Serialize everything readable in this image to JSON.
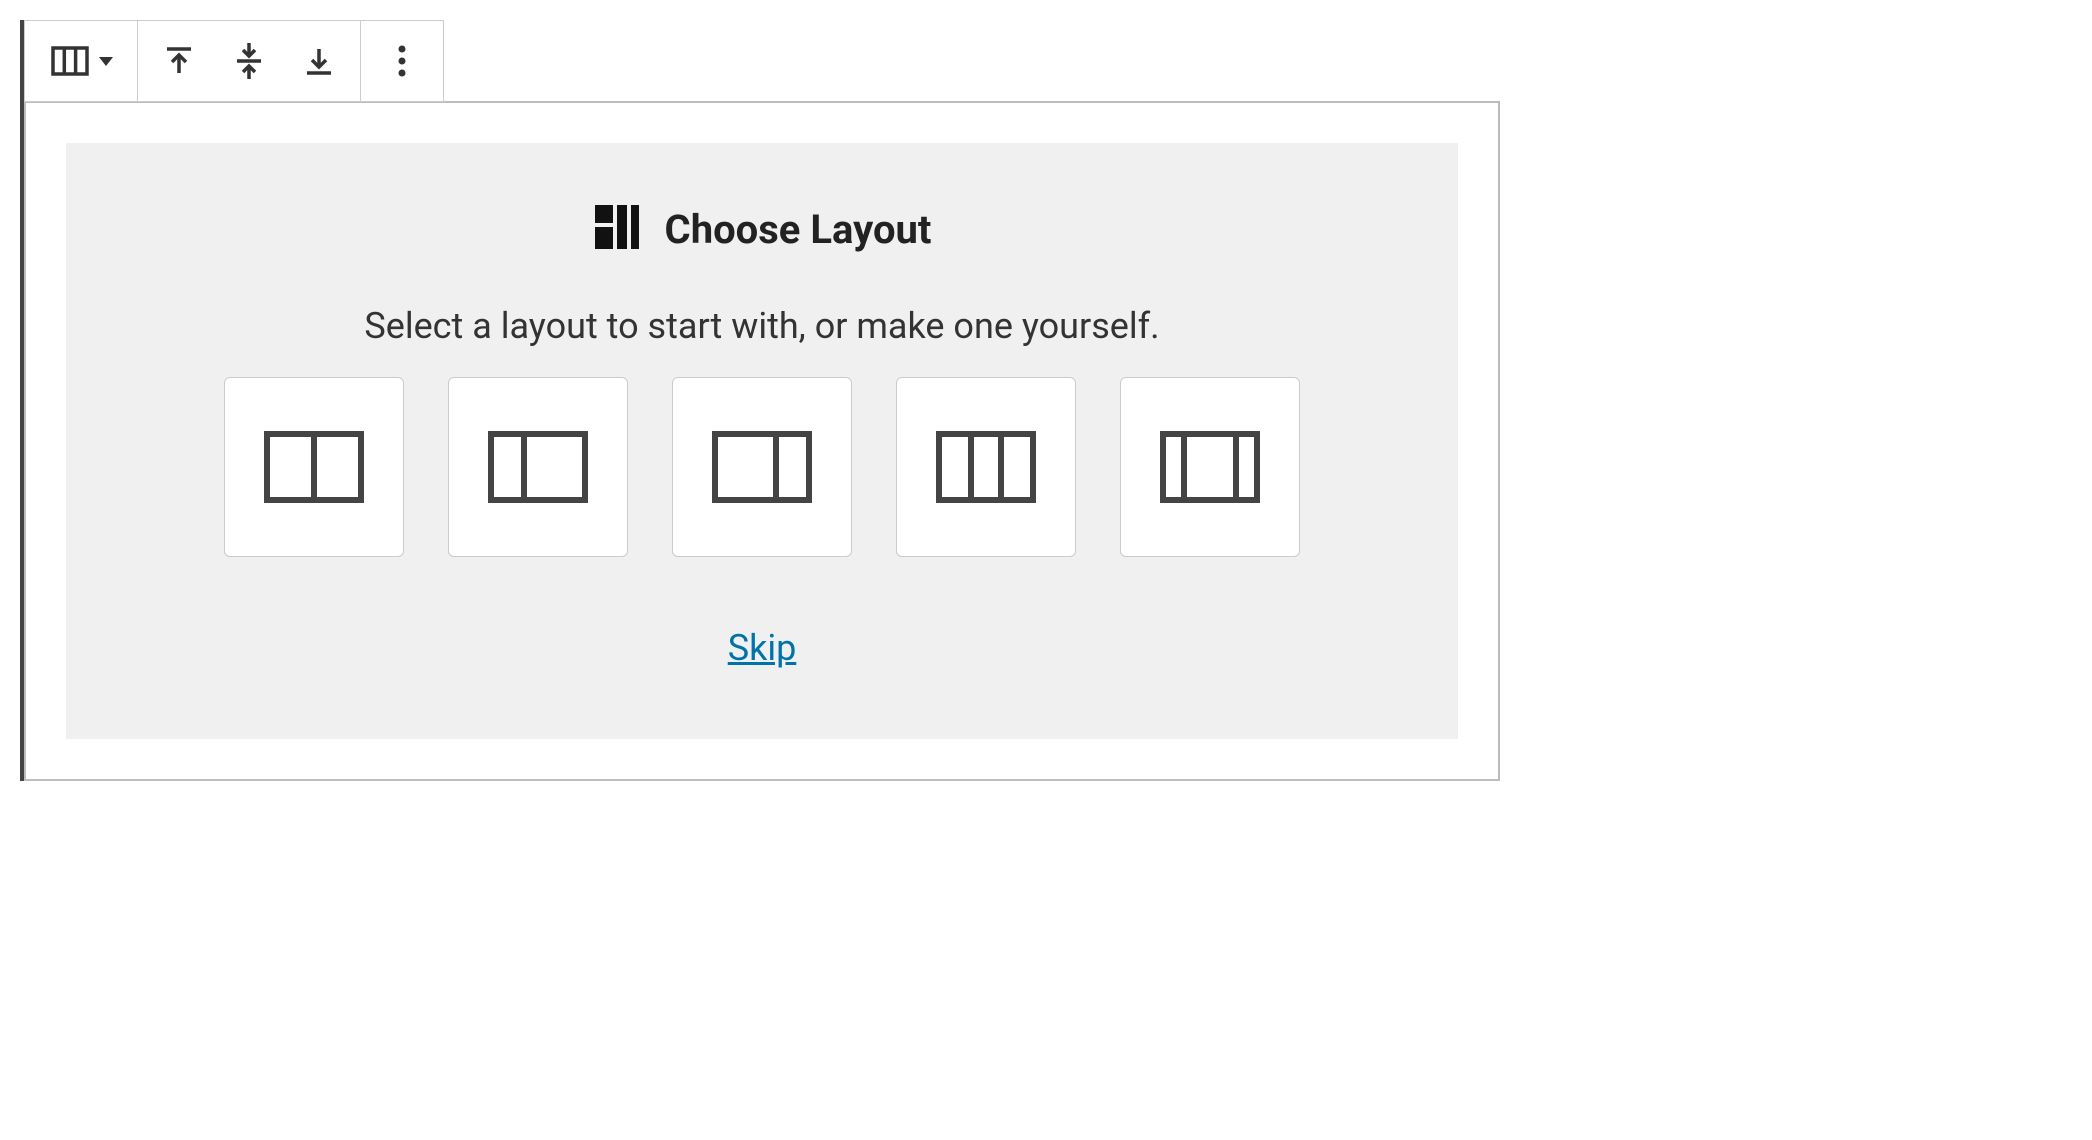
{
  "heading": "Choose Layout",
  "instruction": "Select a layout to start with, or make one yourself.",
  "skip_label": "Skip",
  "layout_options": [
    {
      "id": "two-equal"
    },
    {
      "id": "one-third-two-thirds"
    },
    {
      "id": "two-thirds-one-third"
    },
    {
      "id": "three-equal"
    },
    {
      "id": "wide-center"
    }
  ]
}
